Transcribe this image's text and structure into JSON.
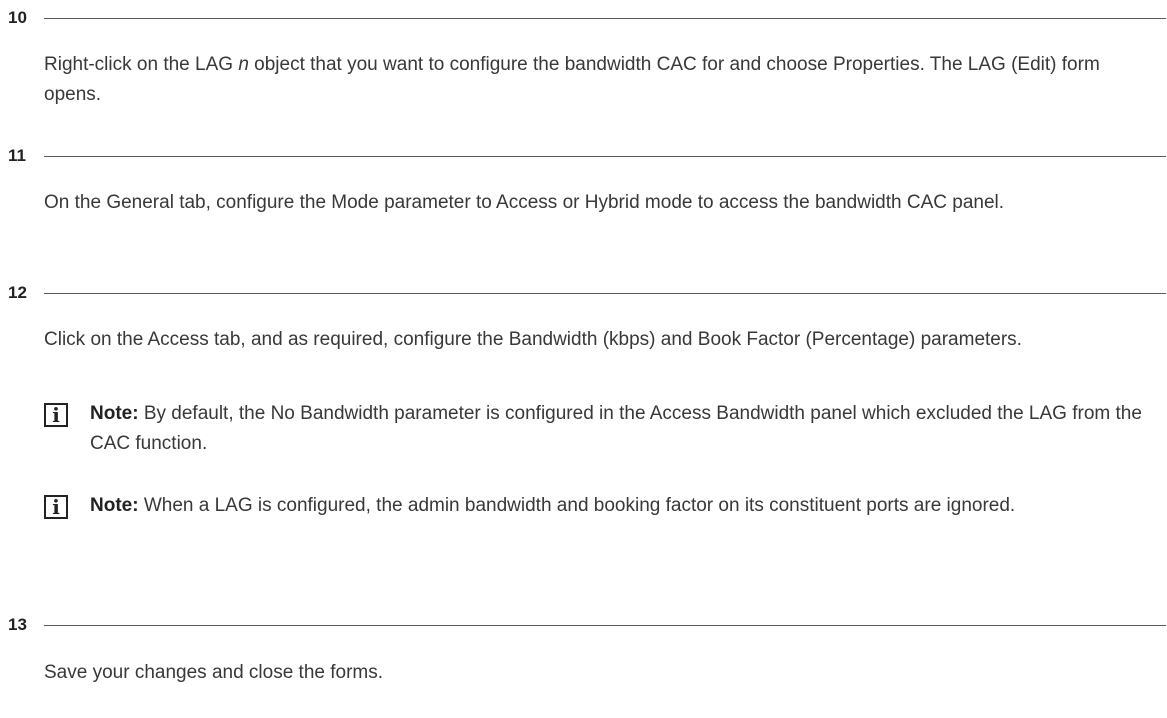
{
  "steps": [
    {
      "number": "10",
      "text_before": "Right-click on the LAG ",
      "text_italic": "n",
      "text_after": " object that you want to configure the bandwidth CAC for and choose Properties. The LAG (Edit) form opens."
    },
    {
      "number": "11",
      "text": "On the General tab, configure the Mode parameter to Access or Hybrid mode to access the bandwidth CAC panel."
    },
    {
      "number": "12",
      "text": "Click on the Access tab, and as required, configure the Bandwidth (kbps) and Book Factor (Percentage) parameters.",
      "notes": [
        {
          "icon": "info-icon",
          "label": "Note:",
          "text": " By default, the No Bandwidth parameter is configured in the Access Bandwidth panel which excluded the LAG from the CAC function."
        },
        {
          "icon": "info-icon",
          "label": "Note:",
          "text": " When a LAG is configured, the admin bandwidth and booking factor on its constituent ports are ignored."
        }
      ]
    },
    {
      "number": "13",
      "text": "Save your changes and close the forms."
    }
  ],
  "note_icon_glyph": "i"
}
